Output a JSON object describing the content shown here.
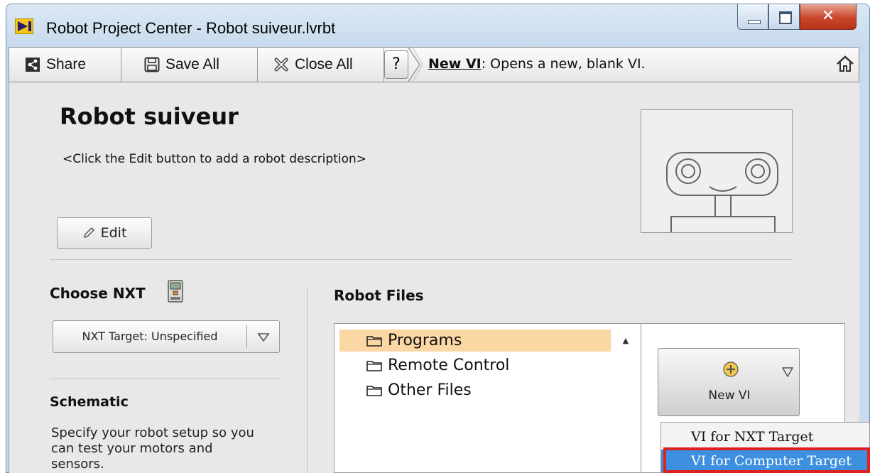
{
  "window": {
    "title": "Robot Project Center - Robot suiveur.lvrbt"
  },
  "toolbar": {
    "share_label": "Share",
    "save_all_label": "Save All",
    "close_all_label": "Close All",
    "help_label": "?",
    "hint_bold": "New VI",
    "hint_text": ": Opens a new, blank VI."
  },
  "robot": {
    "name": "Robot suiveur",
    "description": "<Click the Edit button to add a robot description>",
    "edit_label": "Edit"
  },
  "choose_nxt": {
    "heading": "Choose NXT",
    "target_value": "NXT Target: Unspecified"
  },
  "schematic": {
    "heading": "Schematic",
    "description": "Specify your robot setup so you can test your motors and sensors."
  },
  "robot_files": {
    "heading": "Robot Files",
    "folders": [
      {
        "label": "Programs",
        "selected": true
      },
      {
        "label": "Remote Control",
        "selected": false
      },
      {
        "label": "Other Files",
        "selected": false
      }
    ],
    "new_vi_label": "New VI"
  },
  "new_vi_menu": {
    "items": [
      "VI for NXT Target",
      "VI for Computer Target"
    ],
    "highlighted": "VI for Computer Target",
    "highlight_color": "#3d8fe0",
    "annotation_color": "#e02020"
  }
}
